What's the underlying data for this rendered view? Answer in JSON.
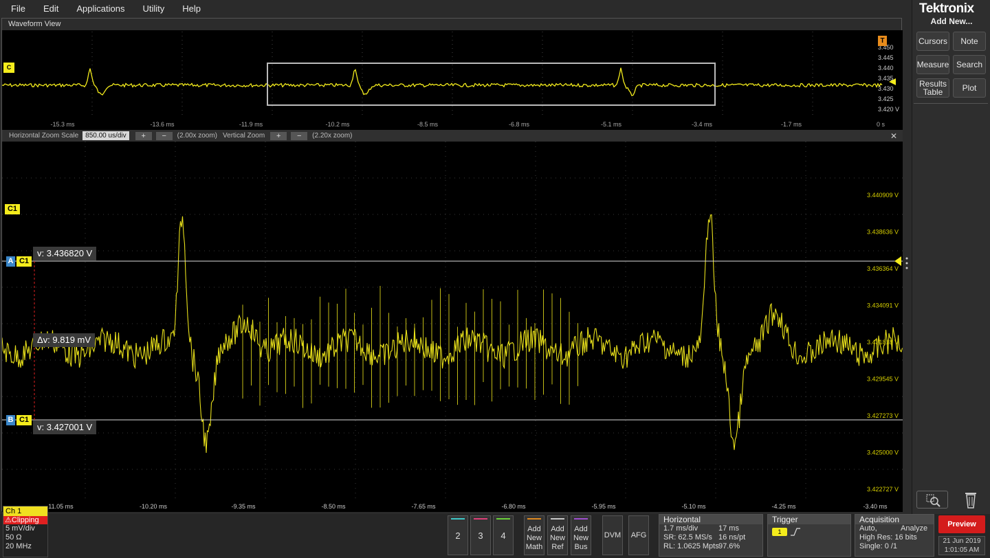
{
  "menu": [
    "File",
    "Edit",
    "Applications",
    "Utility",
    "Help"
  ],
  "brand": "Tektronix",
  "right_panel": {
    "title": "Add New...",
    "buttons": [
      "Cursors",
      "Note",
      "Measure",
      "Search",
      "Results Table",
      "Plot"
    ]
  },
  "waveform_view": {
    "title": "Waveform View",
    "overview_x_ticks": [
      "-15.3 ms",
      "-13.6 ms",
      "-11.9 ms",
      "-10.2 ms",
      "-8.5 ms",
      "-6.8 ms",
      "-5.1 ms",
      "-3.4 ms",
      "-1.7 ms",
      "0 s"
    ],
    "overview_y_ticks": [
      "3.450",
      "3.445",
      "3.440",
      "3.435",
      "3.430",
      "3.425",
      "3.420 V"
    ],
    "overview_channel_tag": "C",
    "trigger_tag": "T"
  },
  "zoom_bar": {
    "h_label": "Horizontal Zoom Scale",
    "h_value": "850.00 us/div",
    "h_zoom": "(2.00x zoom)",
    "v_label": "Vertical Zoom",
    "v_zoom": "(2.20x zoom)",
    "plus": "+",
    "minus": "−",
    "close": "✕"
  },
  "main_plot": {
    "x_ticks": [
      "-11.05 ms",
      "-10.20 ms",
      "-9.35 ms",
      "-8.50 ms",
      "-7.65 ms",
      "-6.80 ms",
      "-5.95 ms",
      "-5.10 ms",
      "-4.25 ms",
      "-3.40 ms"
    ],
    "y_ticks": [
      "3.440909 V",
      "3.438636 V",
      "3.436364 V",
      "3.434091 V",
      "3.431818 V",
      "3.429545 V",
      "3.427273 V",
      "3.425000 V",
      "3.422727 V"
    ],
    "channel_tag": "C1",
    "cursor_a": {
      "letter": "A",
      "channel": "C1",
      "label": "v: 3.436820 V"
    },
    "cursor_b": {
      "letter": "B",
      "channel": "C1",
      "label": "v: 3.427001 V"
    },
    "delta": "Δv: 9.819 mV"
  },
  "ch1": {
    "title": "Ch 1",
    "clipping": "Clipping",
    "scale": "5 mV/div",
    "impedance": "50 Ω",
    "bandwidth": "20 MHz"
  },
  "channel_buttons": [
    {
      "label": "2",
      "color": "#3fc9c9"
    },
    {
      "label": "3",
      "color": "#e0407a"
    },
    {
      "label": "4",
      "color": "#6ad03a"
    }
  ],
  "add_buttons": [
    {
      "l1": "Add",
      "l2": "New",
      "l3": "Math",
      "color": "#e08a20"
    },
    {
      "l1": "Add",
      "l2": "New",
      "l3": "Ref",
      "color": "#c8c8c8"
    },
    {
      "l1": "Add",
      "l2": "New",
      "l3": "Bus",
      "color": "#a050d0"
    }
  ],
  "tool_buttons": [
    "DVM",
    "AFG"
  ],
  "horizontal": {
    "title": "Horizontal",
    "scale": "1.7 ms/div",
    "record": "17 ms",
    "sr": "SR: 62.5 MS/s",
    "res": "16 ns/pt",
    "rl": "RL: 1.0625 Mpts",
    "pct": "97.6%"
  },
  "trigger": {
    "title": "Trigger",
    "source": "1"
  },
  "acquisition": {
    "title": "Acquisition",
    "mode": "Auto,",
    "analyze": "Analyze",
    "hires": "High Res: 16 bits",
    "single": "Single: 0 /1"
  },
  "preview": "Preview",
  "date": "21 Jun 2019",
  "time": "1:01:05 AM",
  "colors": {
    "trace": "#f4ec1c",
    "cursor_a": "#3a86c8"
  }
}
